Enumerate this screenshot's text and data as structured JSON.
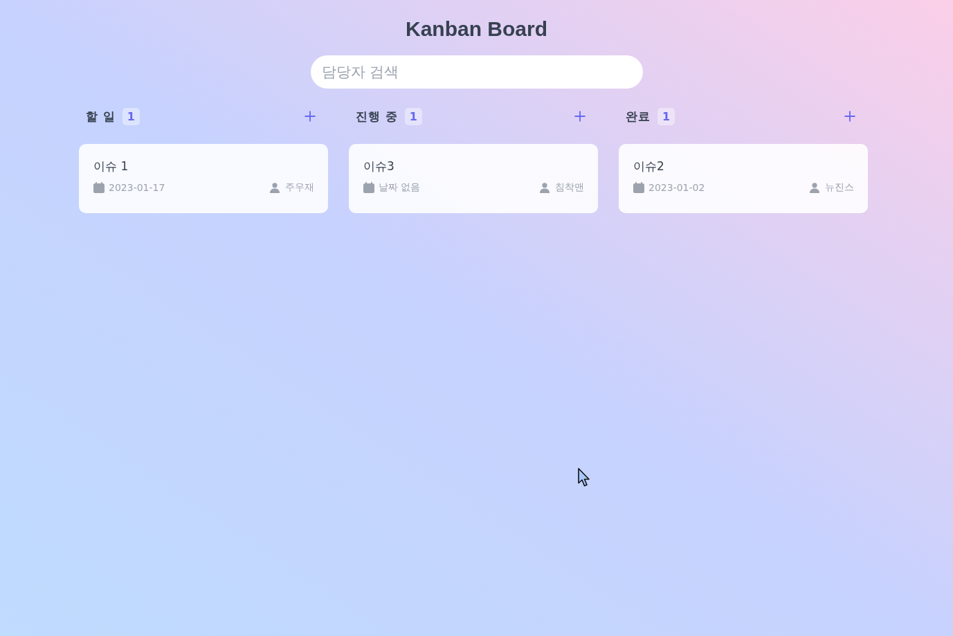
{
  "header": {
    "title": "Kanban Board"
  },
  "search": {
    "placeholder": "담당자 검색"
  },
  "columns": [
    {
      "title": "할 일",
      "count": "1",
      "cards": [
        {
          "title": "이슈 1",
          "date": "2023-01-17",
          "assignee": "주우재"
        }
      ]
    },
    {
      "title": "진행 중",
      "count": "1",
      "cards": [
        {
          "title": "이슈3",
          "date": "날짜 없음",
          "assignee": "침착맨"
        }
      ]
    },
    {
      "title": "완료",
      "count": "1",
      "cards": [
        {
          "title": "이슈2",
          "date": "2023-01-02",
          "assignee": "뉴진스"
        }
      ]
    }
  ]
}
